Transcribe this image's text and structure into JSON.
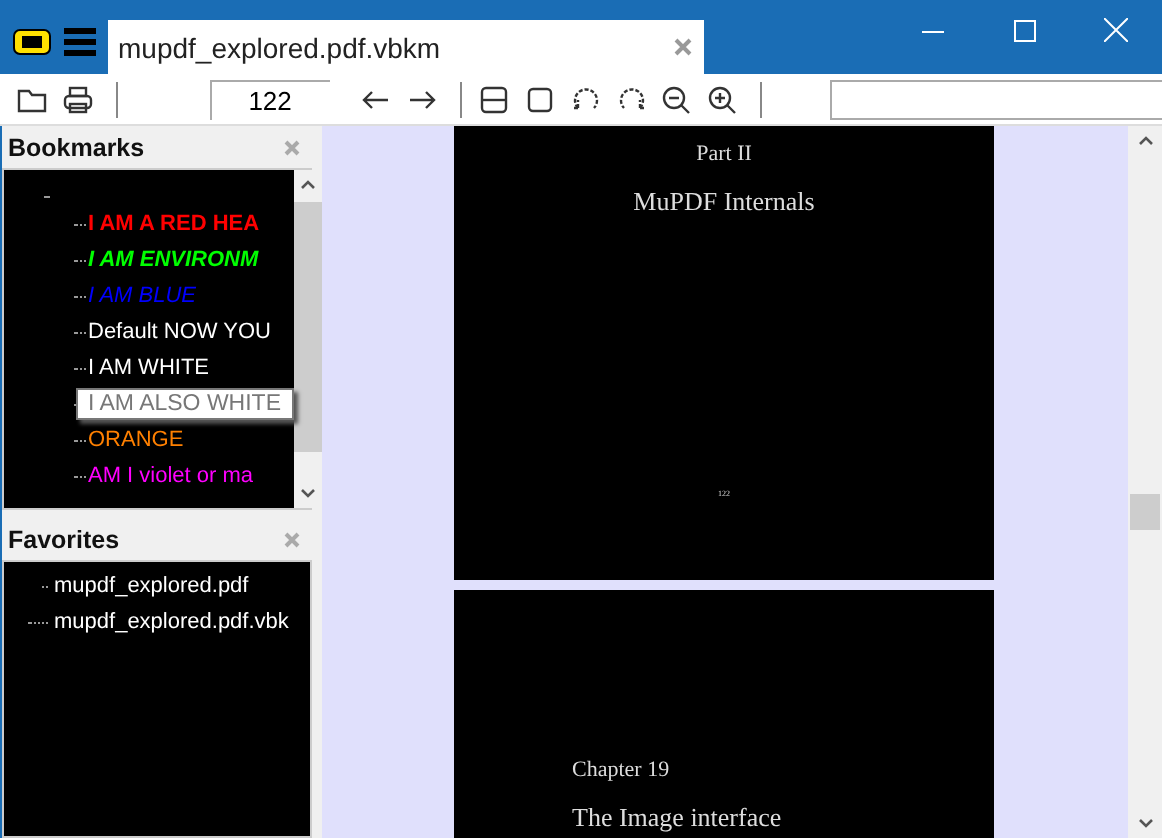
{
  "tab": {
    "title": "mupdf_explored.pdf.vbkm"
  },
  "toolbar": {
    "page_number": "122"
  },
  "bookmarks": {
    "title": "Bookmarks",
    "items": [
      {
        "label": "I AM A RED HEA",
        "color": "#ff0000",
        "bold": true,
        "italic": false,
        "hovered": false
      },
      {
        "label": "I AM ENVIRONM",
        "color": "#00ff00",
        "bold": true,
        "italic": true,
        "hovered": false
      },
      {
        "label": "I AM BLUE",
        "color": "#0000ff",
        "bold": false,
        "italic": true,
        "hovered": false
      },
      {
        "label": "Default NOW YOU",
        "color": "#ffffff",
        "bold": false,
        "italic": false,
        "hovered": false
      },
      {
        "label": "I AM WHITE",
        "color": "#ffffff",
        "bold": false,
        "italic": false,
        "hovered": false
      },
      {
        "label": "I AM ALSO WHITE",
        "hovered": true
      },
      {
        "label": "ORANGE",
        "color": "#ff8000",
        "bold": false,
        "italic": false,
        "hovered": false
      },
      {
        "label": "AM I violet or ma",
        "color": "#ff00ff",
        "bold": false,
        "italic": false,
        "hovered": false
      }
    ]
  },
  "favorites": {
    "title": "Favorites",
    "items": [
      {
        "label": "mupdf_explored.pdf",
        "children": [
          {
            "label": "mupdf_explored.pdf.vbk"
          }
        ]
      }
    ]
  },
  "pages": [
    {
      "heading": "Part II",
      "title": "MuPDF Internals",
      "page_number": "122"
    },
    {
      "heading": "Chapter 19",
      "title": "The Image interface"
    }
  ]
}
